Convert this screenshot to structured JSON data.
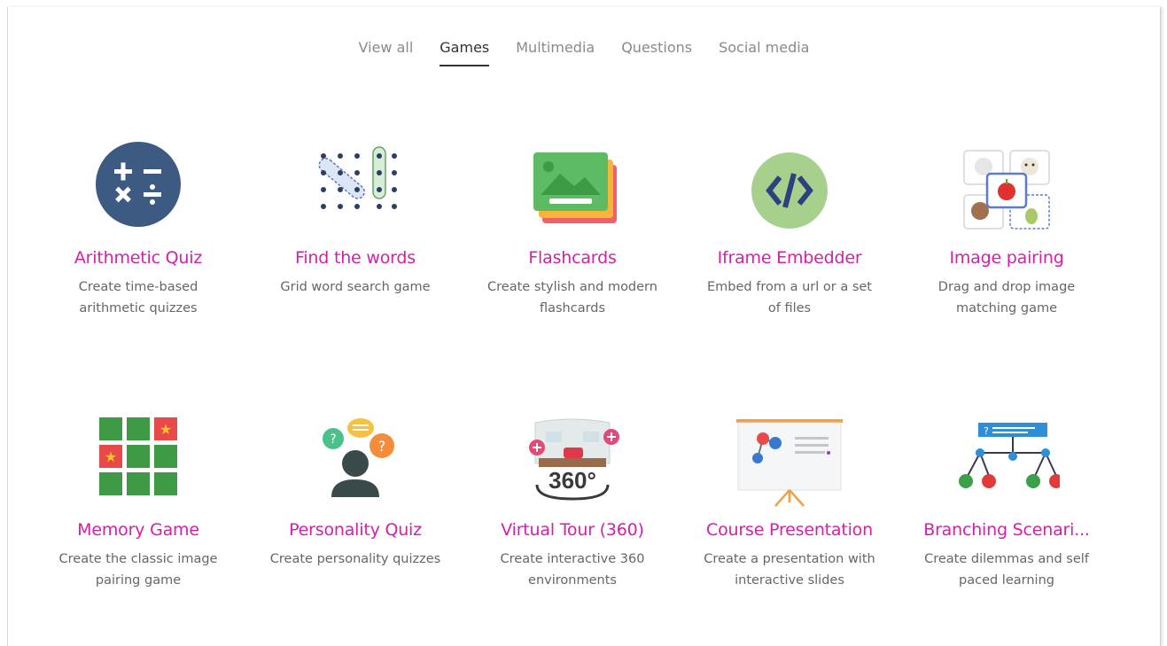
{
  "tabs": [
    {
      "label": "View all",
      "active": false
    },
    {
      "label": "Games",
      "active": true
    },
    {
      "label": "Multimedia",
      "active": false
    },
    {
      "label": "Questions",
      "active": false
    },
    {
      "label": "Social media",
      "active": false
    }
  ],
  "items": [
    {
      "title": "Arithmetic Quiz",
      "desc": "Create time-based arithmetic quizzes",
      "icon": "arithmetic-icon"
    },
    {
      "title": "Find the words",
      "desc": "Grid word search game",
      "icon": "word-search-icon"
    },
    {
      "title": "Flashcards",
      "desc": "Create stylish and modern flashcards",
      "icon": "flashcards-icon"
    },
    {
      "title": "Iframe Embedder",
      "desc": "Embed from a url or a set of files",
      "icon": "code-embed-icon"
    },
    {
      "title": "Image pairing",
      "desc": "Drag and drop image matching game",
      "icon": "image-pairing-icon"
    },
    {
      "title": "Memory Game",
      "desc": "Create the classic image pairing game",
      "icon": "memory-grid-icon"
    },
    {
      "title": "Personality Quiz",
      "desc": "Create personality quizzes",
      "icon": "personality-icon"
    },
    {
      "title": "Virtual Tour (360)",
      "desc": "Create interactive 360 environments",
      "icon": "virtual-tour-icon"
    },
    {
      "title": "Course Presentation",
      "desc": "Create a presentation with interactive slides",
      "icon": "presentation-board-icon"
    },
    {
      "title": "Branching Scenari...",
      "desc": "Create dilemmas and self paced learning",
      "icon": "branching-tree-icon"
    }
  ],
  "colors": {
    "title": "#d61ea8",
    "desc": "#666666",
    "tab_active": "#333333",
    "tab": "#8a8a8a"
  }
}
